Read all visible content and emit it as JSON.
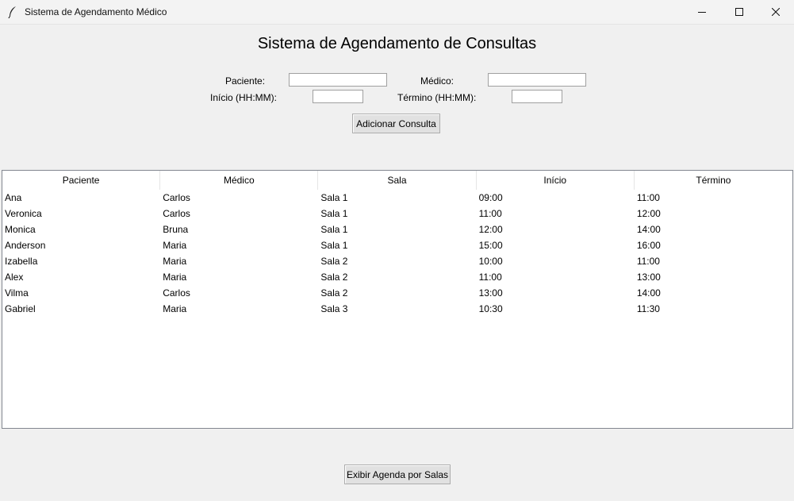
{
  "window": {
    "title": "Sistema de Agendamento Médico",
    "controls": {
      "minimize": "─",
      "maximize": "☐",
      "close": "✕"
    }
  },
  "heading": "Sistema de Agendamento de Consultas",
  "form": {
    "paciente_label": "Paciente:",
    "paciente_value": "",
    "medico_label": "Médico:",
    "medico_value": "",
    "inicio_label": "Início (HH:MM):",
    "inicio_value": "",
    "termino_label": "Término (HH:MM):",
    "termino_value": "",
    "add_button": "Adicionar Consulta"
  },
  "table": {
    "columns": [
      "Paciente",
      "Médico",
      "Sala",
      "Início",
      "Término"
    ],
    "rows": [
      [
        "Ana",
        "Carlos",
        "Sala 1",
        "09:00",
        "11:00"
      ],
      [
        "Veronica",
        "Carlos",
        "Sala 1",
        "11:00",
        "12:00"
      ],
      [
        "Monica",
        "Bruna",
        "Sala 1",
        "12:00",
        "14:00"
      ],
      [
        "Anderson",
        "Maria",
        "Sala 1",
        "15:00",
        "16:00"
      ],
      [
        "Izabella",
        "Maria",
        "Sala 2",
        "10:00",
        "11:00"
      ],
      [
        "Alex",
        "Maria",
        "Sala 2",
        "11:00",
        "13:00"
      ],
      [
        "Vilma",
        "Carlos",
        "Sala 2",
        "13:00",
        "14:00"
      ],
      [
        "Gabriel",
        "Maria",
        "Sala 3",
        "10:30",
        "11:30"
      ]
    ]
  },
  "footer": {
    "show_rooms_button": "Exibir Agenda por Salas"
  },
  "colors": {
    "window_bg": "#f0f0f0",
    "button_bg": "#e1e1e1",
    "tree_bg": "#ffffff"
  }
}
